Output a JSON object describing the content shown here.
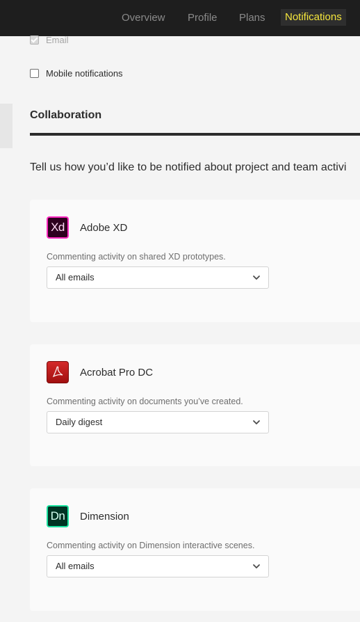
{
  "nav": {
    "overview": "Overview",
    "profile": "Profile",
    "plans": "Plans",
    "notifications": "Notifications",
    "active": "Notifications"
  },
  "checks": {
    "email": {
      "label": "Email",
      "checked": true
    },
    "mobile": {
      "label": "Mobile notifications",
      "checked": false
    }
  },
  "section": {
    "title": "Collaboration",
    "description": "Tell us how you’d like to be notified about project and team activi"
  },
  "cards": [
    {
      "app": "Adobe XD",
      "icon_text": "Xd",
      "icon": "adobe-xd-icon",
      "description": "Commenting activity on shared XD prototypes.",
      "selected": "All emails"
    },
    {
      "app": "Acrobat Pro DC",
      "icon_text": "",
      "icon": "acrobat-icon",
      "description": "Commenting activity on documents you’ve created.",
      "selected": "Daily digest"
    },
    {
      "app": "Dimension",
      "icon_text": "Dn",
      "icon": "adobe-dimension-icon",
      "description": "Commenting activity on Dimension interactive scenes.",
      "selected": "All emails"
    }
  ],
  "colors": {
    "nav_bg": "#1e1e1e",
    "nav_active": "#f5e63c",
    "xd_accent": "#ff2bc2",
    "acrobat_red": "#d42a2a",
    "dimension_accent": "#1ce3a1"
  }
}
